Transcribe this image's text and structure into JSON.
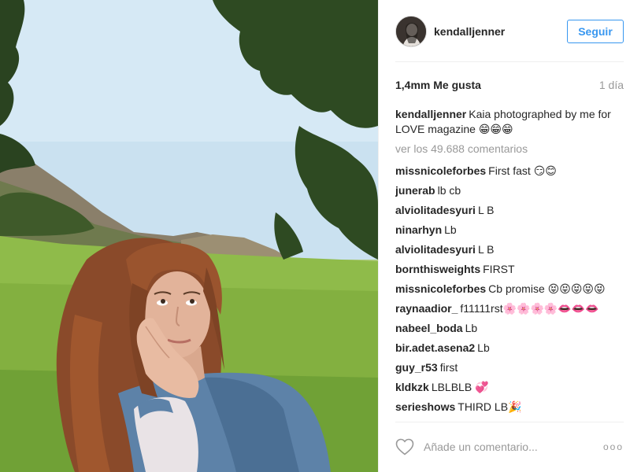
{
  "header": {
    "username": "kendalljenner",
    "follow_label": "Seguir"
  },
  "stats": {
    "likes": "1,4mm Me gusta",
    "time": "1 día"
  },
  "caption": {
    "user": "kendalljenner",
    "text": "Kaia photographed by me for LOVE magazine 😁😁😁"
  },
  "view_all": "ver los 49.688 comentarios",
  "comments": [
    {
      "user": "missnicoleforbes",
      "text": "First fast 😏😊"
    },
    {
      "user": "junerab",
      "text": "lb cb"
    },
    {
      "user": "alviolitadesyuri",
      "text": "L B"
    },
    {
      "user": "ninarhyn",
      "text": "Lb"
    },
    {
      "user": "alviolitadesyuri",
      "text": "L B"
    },
    {
      "user": "bornthisweights",
      "text": "FIRST"
    },
    {
      "user": "missnicoleforbes",
      "text": "Cb promise 😝😝😝😝😝"
    },
    {
      "user": "raynaadior_",
      "text": "f11111rst🌸🌸🌸🌸👄👄👄"
    },
    {
      "user": "nabeel_boda",
      "text": "Lb"
    },
    {
      "user": "bir.adet.asena2",
      "text": "Lb"
    },
    {
      "user": "guy_r53",
      "text": "first"
    },
    {
      "user": "kldkzk",
      "text": "LBLBLB 💞"
    },
    {
      "user": "serieshows",
      "text": "THIRD LB🎉"
    }
  ],
  "footer": {
    "comment_placeholder": "Añade un comentario...",
    "more_label": "ooo"
  },
  "colors": {
    "accent": "#3897f0",
    "text": "#262626",
    "muted": "#999999",
    "divider": "#efefef"
  },
  "icons": {
    "like": "heart-outline-icon",
    "options": "more-options-icon"
  },
  "photo": {
    "subject": "portrait photo"
  }
}
